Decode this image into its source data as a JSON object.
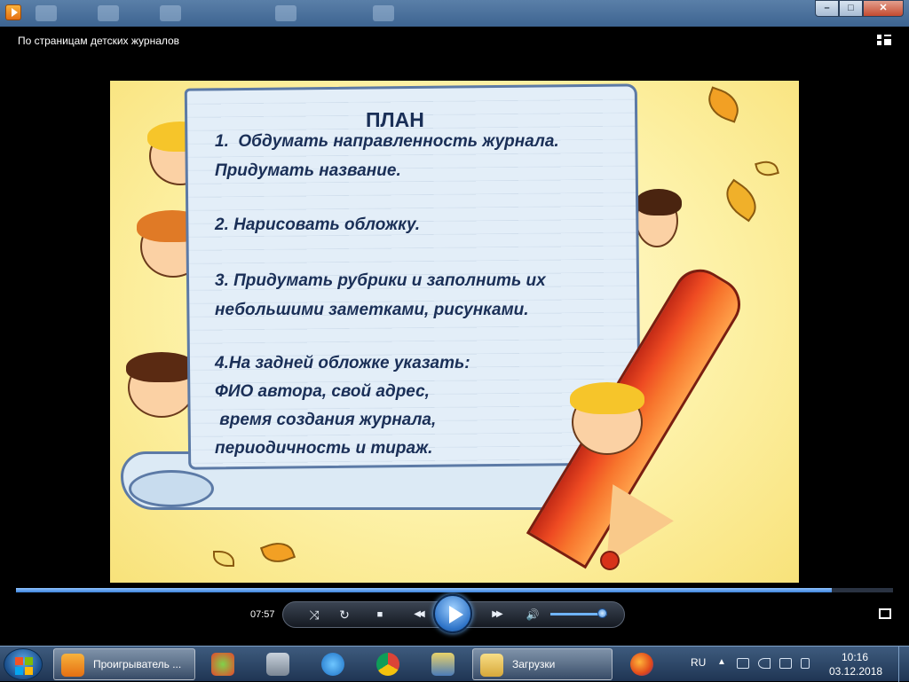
{
  "player": {
    "video_title": "По страницам детских журналов",
    "time_elapsed": "07:57",
    "seek_fraction": 0.93,
    "volume_fraction": 0.9
  },
  "slide": {
    "title": "ПЛАН",
    "lines": [
      "1.  Обдумать направленность журнала.",
      "Придумать название.",
      "2. Нарисовать обложку.",
      "3. Придумать рубрики и заполнить их",
      "небольшими заметками, рисунками.",
      "4.На задней обложке указать:",
      "ФИО автора, свой адрес,",
      " время создания журнала,",
      "периодичность и тираж."
    ]
  },
  "window_controls": {
    "minimize": "–",
    "maximize": "□",
    "close": "✕"
  },
  "controls": {
    "shuffle_icon": "⤨",
    "repeat_icon": "↻",
    "stop_icon": "■",
    "prev_icon": "◀◀",
    "next_icon": "▶▶",
    "volume_icon": "🔊"
  },
  "taskbar": {
    "player_task_label": "Проигрыватель ...",
    "downloads_label": "Загрузки",
    "language": "RU",
    "clock_time": "10:16",
    "clock_date": "03.12.2018"
  },
  "colors": {
    "title_bar": "#3d6491",
    "slide_text": "#1a2f57",
    "accent_blue": "#3d84db"
  }
}
